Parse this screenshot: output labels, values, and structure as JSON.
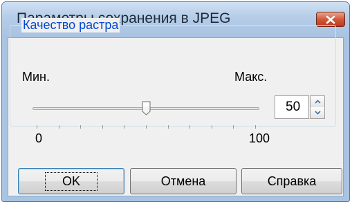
{
  "dialog": {
    "title": "Параметры сохранения в JPEG",
    "close_icon": "close-icon"
  },
  "quality_group": {
    "label": "Качество растра",
    "min_label": "Мин.",
    "max_label": "Макс.",
    "slider_value": 50,
    "slider_min": 0,
    "slider_max": 100,
    "tick_min_label": "0",
    "tick_max_label": "100",
    "value": "50"
  },
  "buttons": {
    "ok": "OK",
    "cancel": "Отмена",
    "help": "Справка"
  },
  "colors": {
    "accent_label": "#0046d5",
    "close_button": "#c0391e"
  }
}
